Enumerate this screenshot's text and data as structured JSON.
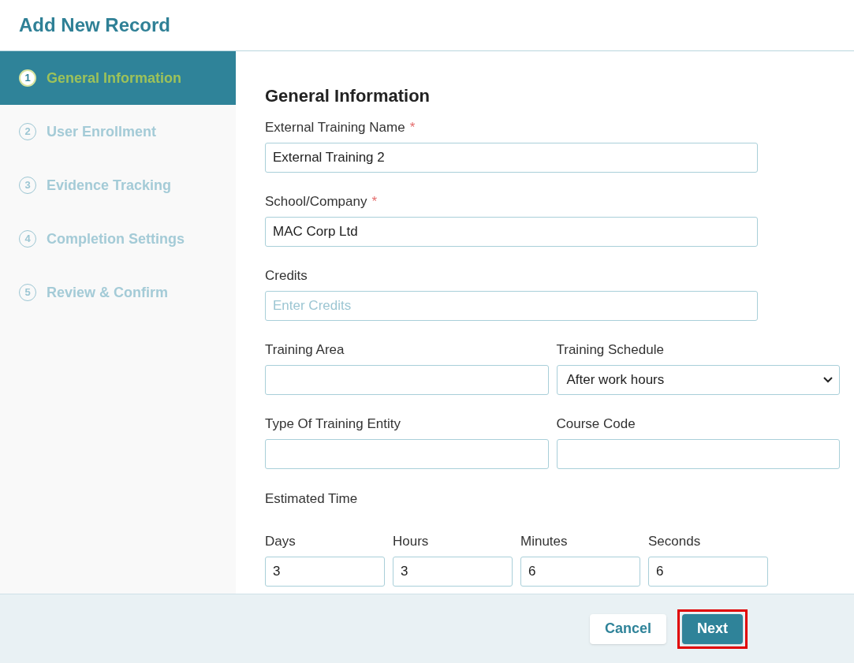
{
  "window": {
    "title": "Add New Record"
  },
  "steps": [
    {
      "number": "1",
      "label": "General Information",
      "selected": true
    },
    {
      "number": "2",
      "label": "User Enrollment",
      "selected": false
    },
    {
      "number": "3",
      "label": "Evidence Tracking",
      "selected": false
    },
    {
      "number": "4",
      "label": "Completion Settings",
      "selected": false
    },
    {
      "number": "5",
      "label": "Review & Confirm",
      "selected": false
    }
  ],
  "form": {
    "heading": "General Information",
    "fields": [
      {
        "kind": "text",
        "label": "External Training Name",
        "required_mark": "*",
        "value": "External Training 2"
      },
      {
        "kind": "text",
        "label": "School/Company",
        "required_mark": "*",
        "value": "MAC Corp Ltd"
      },
      {
        "kind": "text",
        "label": "Credits",
        "placeholder": "Enter Credits"
      }
    ],
    "pairs": [
      [
        {
          "kind": "text",
          "label": "Training Area"
        },
        {
          "kind": "select",
          "label": "Training Schedule",
          "value": "After work hours"
        }
      ],
      [
        {
          "kind": "text",
          "label": "Type Of Training Entity"
        },
        {
          "kind": "text",
          "label": "Course Code"
        }
      ]
    ],
    "estimated_time": {
      "label": "Estimated Time",
      "parts": [
        {
          "label": "Days",
          "value": "3"
        },
        {
          "label": "Hours",
          "value": "3"
        },
        {
          "label": "Minutes",
          "value": "6"
        },
        {
          "label": "Seconds",
          "value": "6"
        }
      ]
    }
  },
  "buttons": [
    {
      "kind": "secondary",
      "label": "Cancel",
      "highlighted": false
    },
    {
      "kind": "primary",
      "label": "Next",
      "highlighted": true
    }
  ]
}
